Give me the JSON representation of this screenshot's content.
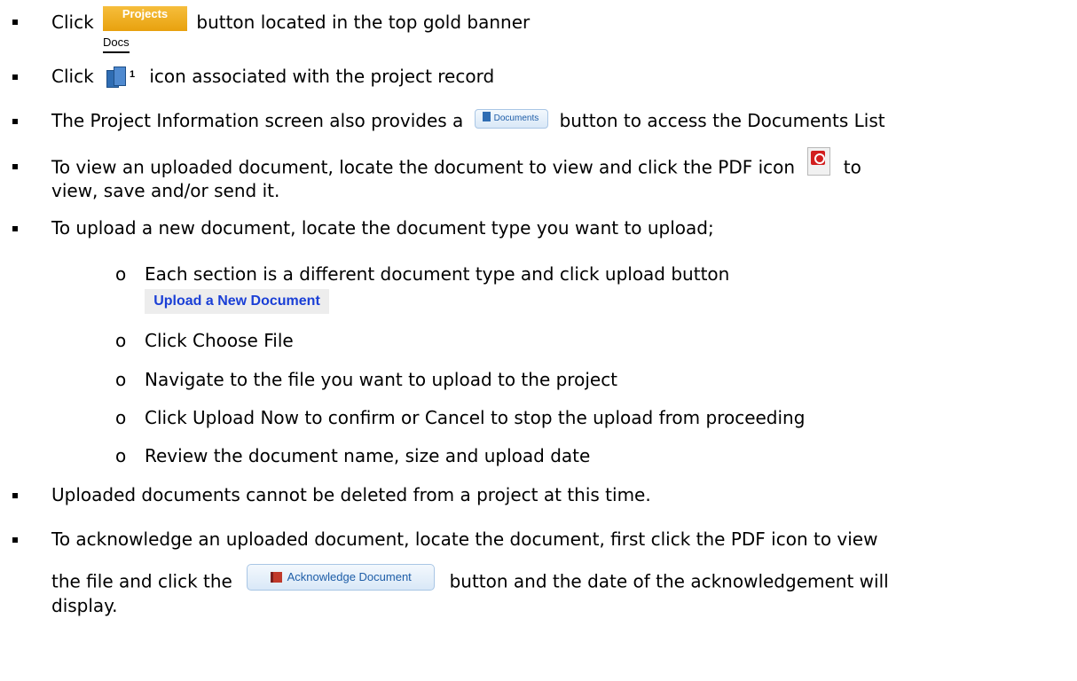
{
  "items": [
    {
      "before": "Click",
      "after": "button located in the top gold banner"
    },
    {
      "before": "Click",
      "after": "icon associated with the project record"
    },
    {
      "before": "The Project Information screen also provides a",
      "after": "button to access the Documents List"
    },
    {
      "line1_before": "To view an uploaded document, locate the document to view and click the PDF icon",
      "line1_after": "to",
      "line2": "view, save and/or send it."
    },
    {
      "text": "To upload a new document, locate the document type you want to upload;"
    },
    {
      "text": "Uploaded documents cannot be deleted from a project at this time."
    },
    {
      "line1": "To acknowledge an uploaded document, locate the document, first click the PDF icon to view",
      "line2_before": "the file and click the",
      "line2_after": "button and the date of the acknowledgement will",
      "line3": "display."
    }
  ],
  "subitems": [
    "Each section is a different document type and click upload button",
    "Click Choose File",
    "Navigate to the file you want to upload to the project",
    "Click Upload Now to confirm or Cancel to stop the upload from proceeding",
    "Review the document name, size and upload date"
  ],
  "sub_marker": "o",
  "ui": {
    "projects_button": "Projects",
    "docs_label": "Docs",
    "docs_count": "1",
    "documents_button": "Documents",
    "upload_button": "Upload a New Document",
    "acknowledge_button": "Acknowledge Document"
  },
  "colors": {
    "projects_gold": "#f0ae22",
    "link_blue": "#1a3fd6",
    "button_blue_text": "#1f5ea8",
    "pdf_red": "#d21f1f"
  }
}
